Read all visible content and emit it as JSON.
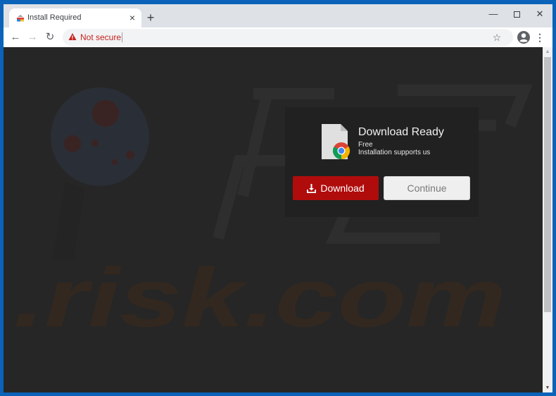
{
  "browser": {
    "tab": {
      "title": "Install Required",
      "close_label": "×"
    },
    "new_tab_label": "+",
    "window_controls": {
      "minimize": "—",
      "close": "✕"
    },
    "nav": {
      "back": "←",
      "forward": "→",
      "reload": "↻"
    },
    "omnibox": {
      "security_label": "Not secure",
      "url_value": "",
      "url_placeholder": ""
    },
    "icons": {
      "star": "☆",
      "menu": "⋮"
    },
    "scrollbar": {
      "up": "▲",
      "down": "▼",
      "thumb_fraction_visible": 0.76,
      "scroll_position": 0
    }
  },
  "page": {
    "watermark_text": "PC risk.com",
    "card": {
      "title": "Download Ready",
      "subtitle_1": "Free",
      "subtitle_2": "Installation supports us",
      "file_icon": "chrome-file-icon"
    },
    "buttons": {
      "download_label": "Download",
      "download_icon": "download-icon",
      "continue_label": "Continue"
    }
  },
  "colors": {
    "window_frame": "#0a63b8",
    "page_background": "#262626",
    "download_button": "#b00c0c",
    "continue_button": "#efefef",
    "not_secure": "#c5221f",
    "watermark_brown": "#33281f"
  }
}
